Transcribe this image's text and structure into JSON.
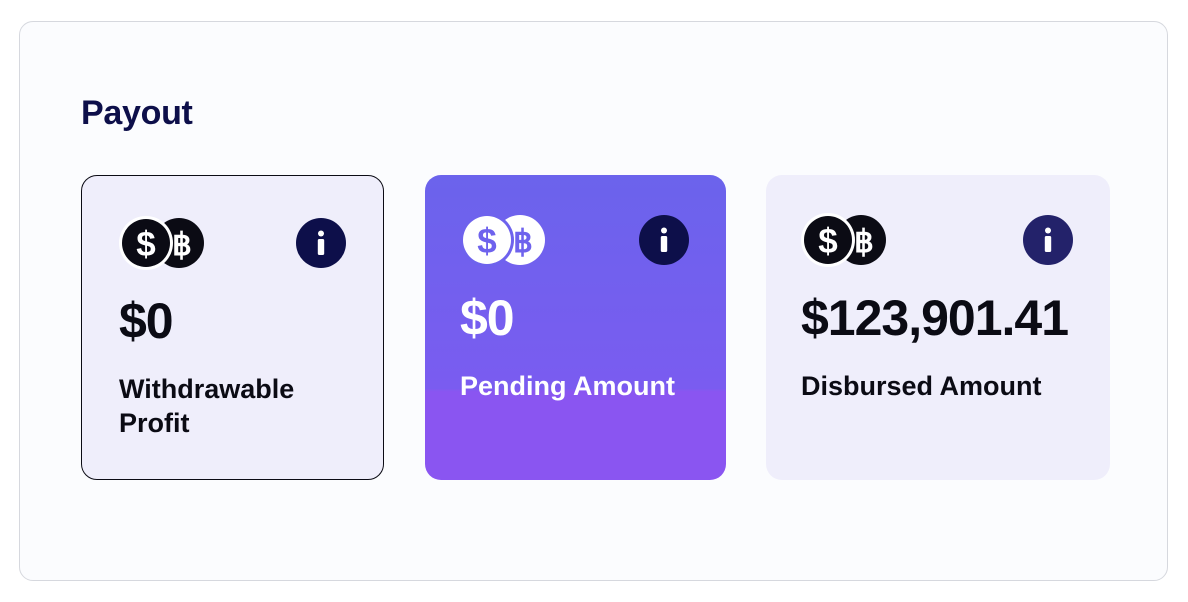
{
  "payout": {
    "title": "Payout",
    "cards": [
      {
        "amount": "$0",
        "label": "Withdrawable Profit",
        "icon": "dollar-bitcoin-coins-icon",
        "info_icon": "info-icon"
      },
      {
        "amount": "$0",
        "label": "Pending Amount",
        "icon": "dollar-bitcoin-coins-icon",
        "info_icon": "info-icon"
      },
      {
        "amount": "$123,901.41",
        "label": "Disbursed Amount",
        "icon": "dollar-bitcoin-coins-icon",
        "info_icon": "info-icon"
      }
    ]
  },
  "colors": {
    "title": "#0d0f4a",
    "card_light_bg": "#efeefb",
    "card_active_gradient_top": "#6b63ec",
    "card_active_gradient_bottom": "#8a55f1",
    "info_button": "#0d0f4a",
    "text_dark": "#0b0b14"
  }
}
